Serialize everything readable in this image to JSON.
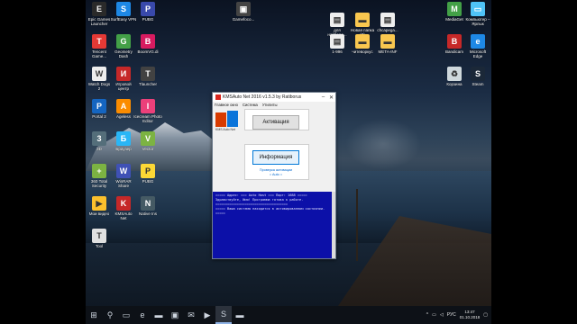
{
  "desktop_icons_left": [
    {
      "label": "Epic Games\nLauncher",
      "icon": "epic-games-icon",
      "color": "#2a2a2a",
      "glyph": "E"
    },
    {
      "label": "SurfEasy VPN",
      "icon": "vpn-icon",
      "color": "#1e88e5",
      "glyph": "S"
    },
    {
      "label": "PUBG",
      "icon": "pubg-icon",
      "color": "#3949ab",
      "glyph": "P"
    },
    {
      "label": "Tencent\nGame...",
      "icon": "tencent-icon",
      "color": "#e53935",
      "glyph": "T"
    },
    {
      "label": "Geometry\nDash",
      "icon": "geometry-dash-icon",
      "color": "#43a047",
      "glyph": "G"
    },
    {
      "label": "BoomVG.di",
      "icon": "boom-icon",
      "color": "#d81b60",
      "glyph": "B"
    },
    {
      "label": "Watch Dogs\n2",
      "icon": "watch-dogs-icon",
      "color": "#eeeeee",
      "glyph": "W"
    },
    {
      "label": "Игровой\nцентр",
      "icon": "game-center-icon",
      "color": "#c62828",
      "glyph": "И"
    },
    {
      "label": "Tlauncher",
      "icon": "tlauncher-icon",
      "color": "#424242",
      "glyph": "T"
    },
    {
      "label": "Portal 2",
      "icon": "portal-icon",
      "color": "#1565c0",
      "glyph": "P"
    },
    {
      "label": "Ageless",
      "icon": "ageless-icon",
      "color": "#fb8c00",
      "glyph": "A"
    },
    {
      "label": "Icecream Photo\nEditor",
      "icon": "icecream-icon",
      "color": "#ec407a",
      "glyph": "I"
    },
    {
      "label": "3D",
      "icon": "3d-icon",
      "color": "#546e7a",
      "glyph": "3"
    },
    {
      "label": "Браузер",
      "icon": "browser-icon",
      "color": "#29b6f6",
      "glyph": "Б"
    },
    {
      "label": "Vector",
      "icon": "vector-icon",
      "color": "#7cb342",
      "glyph": "V"
    },
    {
      "label": "360 Total\nSecurity",
      "icon": "security-icon",
      "color": "#7cb342",
      "glyph": "+"
    },
    {
      "label": "WinRAR\nShare",
      "icon": "winrar-icon",
      "color": "#3f51b5",
      "glyph": "W"
    },
    {
      "label": "PUBG",
      "icon": "pubg-icon-2",
      "color": "#fdd835",
      "glyph": "P"
    },
    {
      "label": "Мои видео",
      "icon": "videos-icon",
      "color": "#fbc02d",
      "glyph": "▶"
    },
    {
      "label": "KMSAuto\nNet",
      "icon": "kmsauto-icon",
      "color": "#c62828",
      "glyph": "K"
    },
    {
      "label": "Native Ins",
      "icon": "native-icon",
      "color": "#455a64",
      "glyph": "N"
    },
    {
      "label": "Tool",
      "icon": "tool-icon",
      "color": "#e0e0e0",
      "glyph": "T"
    }
  ],
  "desktop_icons_top": [
    {
      "label": "Gamefoco...",
      "icon": "folder-icon",
      "color": "#444444",
      "glyph": "▣"
    },
    {
      "label": "для\nнайбера...",
      "icon": "document-icon",
      "color": "#eeeeee",
      "glyph": "▤"
    },
    {
      "label": "Новая папка\n(3)",
      "icon": "folder-icon",
      "color": "#f9c74f",
      "glyph": "▬"
    },
    {
      "label": "chcapega...",
      "icon": "document-icon",
      "color": "#eeeeee",
      "glyph": "▤"
    },
    {
      "label": "1-996",
      "icon": "document-icon",
      "color": "#eeeeee",
      "glyph": "▤"
    },
    {
      "label": "читеворкус",
      "icon": "folder-icon",
      "color": "#f9c74f",
      "glyph": "▬"
    },
    {
      "label": "META-INF",
      "icon": "folder-icon",
      "color": "#f9c74f",
      "glyph": "▬"
    }
  ],
  "desktop_icons_right": [
    {
      "label": "MediaGet",
      "icon": "mediaget-icon",
      "color": "#43a047",
      "glyph": "M"
    },
    {
      "label": "Компьютер –\nЯрлык",
      "icon": "computer-icon",
      "color": "#4fc3f7",
      "glyph": "▭"
    },
    {
      "label": "Bandicam",
      "icon": "bandicam-icon",
      "color": "#c62828",
      "glyph": "B"
    },
    {
      "label": "Microsoft\nEdge",
      "icon": "edge-icon",
      "color": "#1e88e5",
      "glyph": "e"
    },
    {
      "label": "Корзина",
      "icon": "recycle-bin-icon",
      "color": "#cfd8dc",
      "glyph": "♻"
    },
    {
      "label": "Steam",
      "icon": "steam-icon",
      "color": "#1b2838",
      "glyph": "S"
    }
  ],
  "window": {
    "title": "KMSAuto Net 2016 v1.5.3 by Ratiborus",
    "menu": [
      "Главное окно",
      "Система",
      "Утилиты"
    ],
    "logo_text": "KMS Auto Net",
    "activate_label": "Активация",
    "info_label": "Информация",
    "link_label": "Проверка активации",
    "link2_label": "= Auto =",
    "console_lines": [
      "===== Адрес: === Auto Host === Порт: 1688 =====",
      "Здравствуйте, Имя! Программа готова к работе.",
      "=====================================",
      "===== Ваша система находится в активированном состоянии. ====="
    ]
  },
  "taskbar": {
    "items": [
      {
        "name": "start-button",
        "glyph": "⊞"
      },
      {
        "name": "search-button",
        "glyph": "⚲"
      },
      {
        "name": "task-view-button",
        "glyph": "▭"
      },
      {
        "name": "edge-taskbar",
        "glyph": "e"
      },
      {
        "name": "explorer-taskbar",
        "glyph": "▬"
      },
      {
        "name": "store-taskbar",
        "glyph": "▣"
      },
      {
        "name": "mail-taskbar",
        "glyph": "✉"
      },
      {
        "name": "media-taskbar",
        "glyph": "▶"
      },
      {
        "name": "kmsauto-taskbar",
        "glyph": "S"
      },
      {
        "name": "folder-taskbar",
        "glyph": "▬"
      }
    ],
    "lang": "РУС",
    "time": "13:47",
    "date": "01.10.2018"
  }
}
